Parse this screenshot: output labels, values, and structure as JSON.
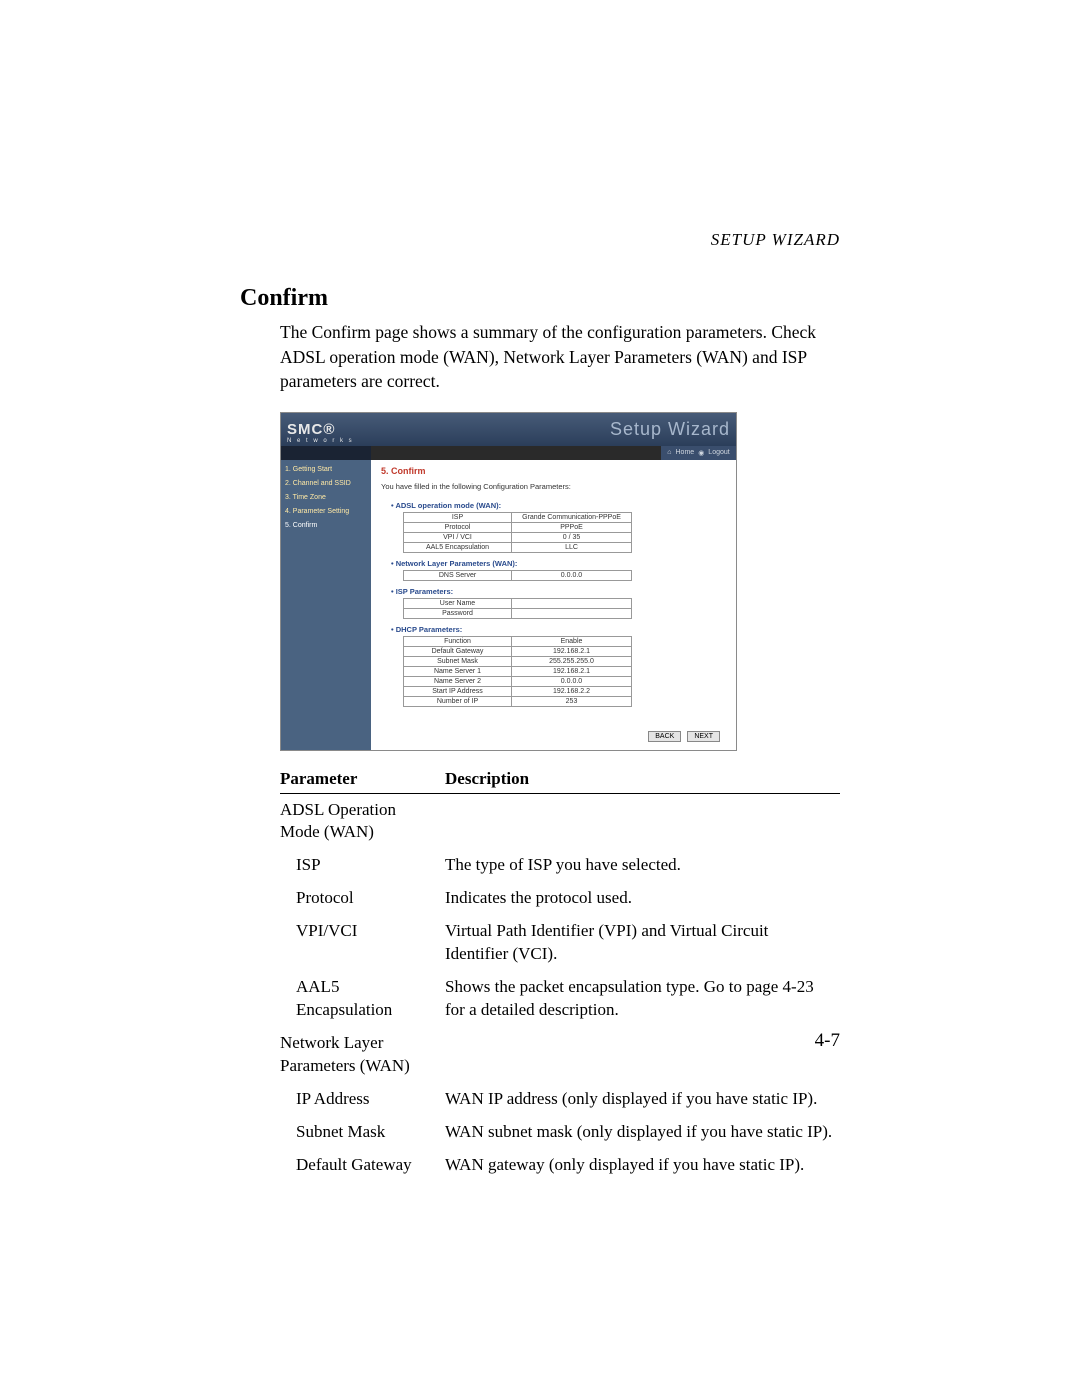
{
  "header_right": "SETUP WIZARD",
  "section_title": "Confirm",
  "intro": "The Confirm page shows a summary of the configuration parameters. Check ADSL operation mode (WAN), Network Layer Parameters (WAN) and ISP parameters are correct.",
  "page_number": "4-7",
  "screenshot": {
    "brand_top": "SMC®",
    "brand_sub": "N e t w o r k s",
    "title": "Setup Wizard",
    "home_label": "Home",
    "logout_label": "Logout",
    "nav": [
      "1. Getting Start",
      "2. Channel and SSID",
      "3. Time Zone",
      "4. Parameter Setting",
      "5. Confirm"
    ],
    "confirm_head": "5. Confirm",
    "confirm_sub": "You have filled in the following Configuration Parameters:",
    "groups": [
      {
        "title": "ADSL operation mode (WAN):",
        "rows": [
          [
            "ISP",
            "Grande Communication-PPPoE"
          ],
          [
            "Protocol",
            "PPPoE"
          ],
          [
            "VPI / VCI",
            "0 / 35"
          ],
          [
            "AAL5 Encapsulation",
            "LLC"
          ]
        ]
      },
      {
        "title": "Network Layer Parameters (WAN):",
        "rows": [
          [
            "DNS Server",
            "0.0.0.0"
          ]
        ]
      },
      {
        "title": "ISP Parameters:",
        "rows": [
          [
            "User Name",
            ""
          ],
          [
            "Password",
            ""
          ]
        ]
      },
      {
        "title": "DHCP Parameters:",
        "rows": [
          [
            "Function",
            "Enable"
          ],
          [
            "Default Gateway",
            "192.168.2.1"
          ],
          [
            "Subnet Mask",
            "255.255.255.0"
          ],
          [
            "Name Server 1",
            "192.168.2.1"
          ],
          [
            "Name Server 2",
            "0.0.0.0"
          ],
          [
            "Start IP Address",
            "192.168.2.2"
          ],
          [
            "Number of IP",
            "253"
          ]
        ]
      }
    ],
    "back_label": "BACK",
    "next_label": "NEXT"
  },
  "doc_table": {
    "col_param": "Parameter",
    "col_desc": "Description",
    "rows": [
      {
        "param": "ADSL Operation Mode (WAN)",
        "desc": "",
        "sub": false
      },
      {
        "param": "ISP",
        "desc": "The type of ISP you have selected.",
        "sub": true
      },
      {
        "param": "Protocol",
        "desc": "Indicates the protocol used.",
        "sub": true
      },
      {
        "param": "VPI/VCI",
        "desc": "Virtual Path Identifier (VPI) and Virtual Circuit Identifier (VCI).",
        "sub": true
      },
      {
        "param": "AAL5 Encapsulation",
        "desc": "Shows the packet encapsulation type. Go to page 4-23 for a detailed description.",
        "sub": true
      },
      {
        "param": "Network Layer Parameters (WAN)",
        "desc": "",
        "sub": false
      },
      {
        "param": "IP Address",
        "desc": "WAN IP address (only displayed if you have static IP).",
        "sub": true
      },
      {
        "param": "Subnet Mask",
        "desc": "WAN subnet mask (only displayed if you have static IP).",
        "sub": true
      },
      {
        "param": "Default Gateway",
        "desc": "WAN gateway (only displayed if you have static IP).",
        "sub": true
      }
    ]
  }
}
